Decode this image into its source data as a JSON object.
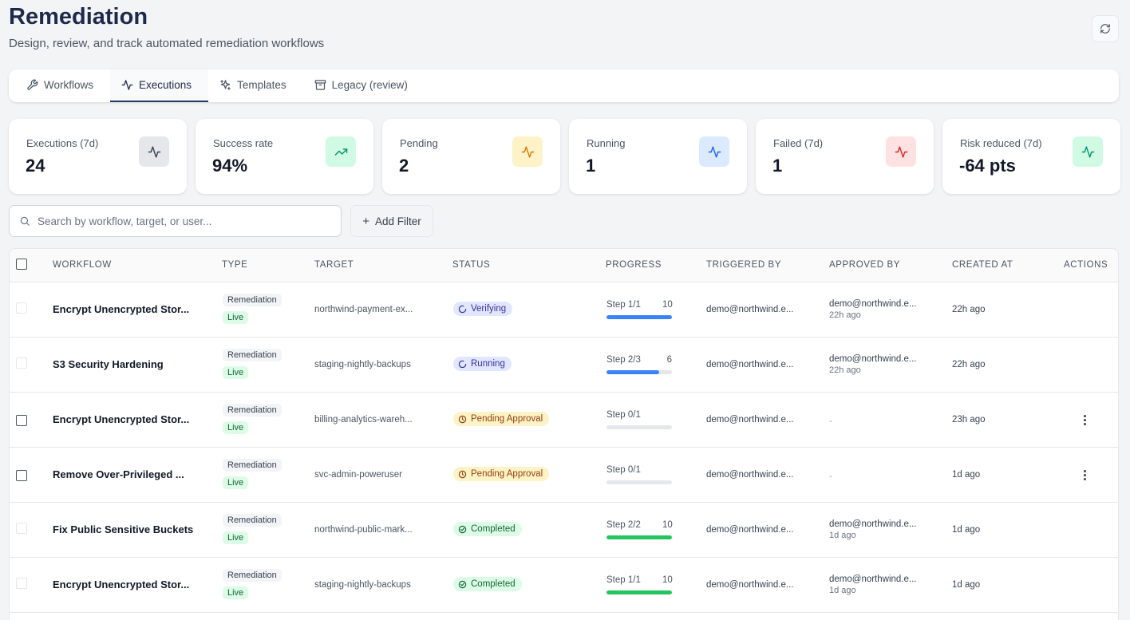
{
  "header": {
    "title": "Remediation",
    "subtitle": "Design, review, and track automated remediation workflows"
  },
  "tabs": [
    {
      "label": "Workflows",
      "icon": "wrench-icon",
      "active": false
    },
    {
      "label": "Executions",
      "icon": "activity-icon",
      "active": true
    },
    {
      "label": "Templates",
      "icon": "sparkles-icon",
      "active": false
    },
    {
      "label": "Legacy (review)",
      "icon": "archive-icon",
      "active": false
    }
  ],
  "stats": [
    {
      "label": "Executions (7d)",
      "value": "24",
      "icon": "activity-icon",
      "bg": "#e5e7eb",
      "color": "#374151"
    },
    {
      "label": "Success rate",
      "value": "94%",
      "icon": "trending-up-icon",
      "bg": "#d1fae5",
      "color": "#059669"
    },
    {
      "label": "Pending",
      "value": "2",
      "icon": "activity-icon",
      "bg": "#fef3c7",
      "color": "#d97706"
    },
    {
      "label": "Running",
      "value": "1",
      "icon": "activity-icon",
      "bg": "#dbeafe",
      "color": "#2563eb"
    },
    {
      "label": "Failed (7d)",
      "value": "1",
      "icon": "activity-icon",
      "bg": "#fee2e2",
      "color": "#dc2626"
    },
    {
      "label": "Risk reduced (7d)",
      "value": "-64 pts",
      "icon": "activity-icon",
      "bg": "#d1fae5",
      "color": "#059669"
    }
  ],
  "search": {
    "placeholder": "Search by workflow, target, or user..."
  },
  "filter": {
    "label": "Add Filter"
  },
  "table": {
    "columns": [
      "WORKFLOW",
      "TYPE",
      "TARGET",
      "STATUS",
      "PROGRESS",
      "TRIGGERED BY",
      "APPROVED BY",
      "CREATED AT",
      "ACTIONS"
    ],
    "rows": [
      {
        "workflow": "Encrypt Unencrypted Stor...",
        "type": "Remediation",
        "mode": "Live",
        "target": "northwind-payment-ex...",
        "status": "Verifying",
        "status_kind": "verifying",
        "step": "Step 1/1",
        "count": "10",
        "progress": 1.0,
        "bar_color": "#3b82f6",
        "triggered_by": "demo@northwind.e...",
        "approved_by": "demo@northwind.e...",
        "approved_ago": "22h ago",
        "created": "22h ago",
        "selectable": false
      },
      {
        "workflow": "S3 Security Hardening",
        "type": "Remediation",
        "mode": "Live",
        "target": "staging-nightly-backups",
        "status": "Running",
        "status_kind": "running",
        "step": "Step 2/3",
        "count": "6",
        "progress": 0.8,
        "bar_color": "#3b82f6",
        "triggered_by": "demo@northwind.e...",
        "approved_by": "demo@northwind.e...",
        "approved_ago": "22h ago",
        "created": "22h ago",
        "selectable": false
      },
      {
        "workflow": "Encrypt Unencrypted Stor...",
        "type": "Remediation",
        "mode": "Live",
        "target": "billing-analytics-wareh...",
        "status": "Pending Approval",
        "status_kind": "pending",
        "step": "Step 0/1",
        "count": "",
        "progress": 0,
        "bar_color": "#3b82f6",
        "triggered_by": "demo@northwind.e...",
        "approved_by": "-",
        "approved_ago": "",
        "created": "23h ago",
        "selectable": true
      },
      {
        "workflow": "Remove Over-Privileged ...",
        "type": "Remediation",
        "mode": "Live",
        "target": "svc-admin-poweruser",
        "status": "Pending Approval",
        "status_kind": "pending",
        "step": "Step 0/1",
        "count": "",
        "progress": 0,
        "bar_color": "#3b82f6",
        "triggered_by": "demo@northwind.e...",
        "approved_by": "-",
        "approved_ago": "",
        "created": "1d ago",
        "selectable": true
      },
      {
        "workflow": "Fix Public Sensitive Buckets",
        "type": "Remediation",
        "mode": "Live",
        "target": "northwind-public-mark...",
        "status": "Completed",
        "status_kind": "completed",
        "step": "Step 2/2",
        "count": "10",
        "progress": 1.0,
        "bar_color": "#22c55e",
        "triggered_by": "demo@northwind.e...",
        "approved_by": "demo@northwind.e...",
        "approved_ago": "1d ago",
        "created": "1d ago",
        "selectable": false
      },
      {
        "workflow": "Encrypt Unencrypted Stor...",
        "type": "Remediation",
        "mode": "Live",
        "target": "staging-nightly-backups",
        "status": "Completed",
        "status_kind": "completed",
        "step": "Step 1/1",
        "count": "10",
        "progress": 1.0,
        "bar_color": "#22c55e",
        "triggered_by": "demo@northwind.e...",
        "approved_by": "demo@northwind.e...",
        "approved_ago": "1d ago",
        "created": "1d ago",
        "selectable": false
      }
    ]
  }
}
